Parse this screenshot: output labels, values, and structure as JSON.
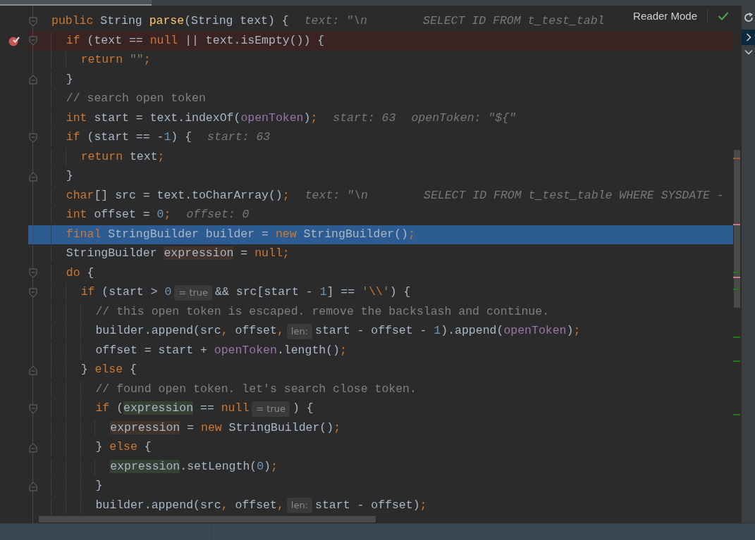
{
  "editor": {
    "lines": [
      {
        "kind": "fold-start",
        "breakpoint": false,
        "current": false,
        "tokens": [
          {
            "kind": "kw",
            "text": "public"
          },
          {
            "kind": "id",
            "text": " String "
          },
          {
            "kind": "fn",
            "text": "parse"
          },
          {
            "kind": "id",
            "text": "(String text) {"
          },
          {
            "kind": "hint",
            "text": "text: \"\\n        SELECT ID FROM t_test_tabl"
          }
        ]
      },
      {
        "kind": "fold-start",
        "breakpoint": true,
        "current": false,
        "tokens": [
          {
            "kind": "kw",
            "text": "  if"
          },
          {
            "kind": "id",
            "text": " (text == "
          },
          {
            "kind": "kw",
            "text": "null"
          },
          {
            "kind": "id",
            "text": " || text.isEmpty()) {"
          }
        ]
      },
      {
        "kind": "plain",
        "breakpoint": false,
        "current": false,
        "tokens": [
          {
            "kind": "kw",
            "text": "    return "
          },
          {
            "kind": "str",
            "text": "\"\""
          },
          {
            "kind": "kw",
            "text": ";"
          }
        ]
      },
      {
        "kind": "fold-end",
        "breakpoint": false,
        "current": false,
        "tokens": [
          {
            "kind": "id",
            "text": "  }"
          }
        ]
      },
      {
        "kind": "plain",
        "breakpoint": false,
        "current": false,
        "tokens": [
          {
            "kind": "comment",
            "text": "  // search open token"
          }
        ]
      },
      {
        "kind": "plain",
        "breakpoint": false,
        "current": false,
        "tokens": [
          {
            "kind": "kw",
            "text": "  int"
          },
          {
            "kind": "id",
            "text": " start = text.indexOf("
          },
          {
            "kind": "field",
            "text": "openToken"
          },
          {
            "kind": "id",
            "text": ")"
          },
          {
            "kind": "kw",
            "text": ";"
          },
          {
            "kind": "hint",
            "text": "start: 63"
          },
          {
            "kind": "hint",
            "text": "openToken: \"${\""
          }
        ]
      },
      {
        "kind": "fold-start",
        "breakpoint": false,
        "current": false,
        "tokens": [
          {
            "kind": "kw",
            "text": "  if"
          },
          {
            "kind": "id",
            "text": " (start == -"
          },
          {
            "kind": "num",
            "text": "1"
          },
          {
            "kind": "id",
            "text": ") {"
          },
          {
            "kind": "hint",
            "text": "start: 63"
          }
        ]
      },
      {
        "kind": "plain",
        "breakpoint": false,
        "current": false,
        "tokens": [
          {
            "kind": "kw",
            "text": "    return"
          },
          {
            "kind": "id",
            "text": " text"
          },
          {
            "kind": "kw",
            "text": ";"
          }
        ]
      },
      {
        "kind": "fold-end",
        "breakpoint": false,
        "current": false,
        "tokens": [
          {
            "kind": "id",
            "text": "  }"
          }
        ]
      },
      {
        "kind": "plain",
        "breakpoint": false,
        "current": false,
        "tokens": [
          {
            "kind": "kw",
            "text": "  char"
          },
          {
            "kind": "id",
            "text": "[] src = text.toCharArray()"
          },
          {
            "kind": "kw",
            "text": ";"
          },
          {
            "kind": "hint",
            "text": "text: \"\\n        SELECT ID FROM t_test_table WHERE SYSDATE -"
          }
        ]
      },
      {
        "kind": "plain",
        "breakpoint": false,
        "current": false,
        "tokens": [
          {
            "kind": "kw",
            "text": "  int"
          },
          {
            "kind": "id",
            "text": " offset = "
          },
          {
            "kind": "num",
            "text": "0"
          },
          {
            "kind": "kw",
            "text": ";"
          },
          {
            "kind": "hint",
            "text": "offset: 0"
          }
        ]
      },
      {
        "kind": "plain",
        "breakpoint": false,
        "current": true,
        "tokens": [
          {
            "kind": "kw",
            "text": "  final"
          },
          {
            "kind": "id",
            "text": " StringBuilder builder = "
          },
          {
            "kind": "kw",
            "text": "new"
          },
          {
            "kind": "id",
            "text": " StringBuilder()"
          },
          {
            "kind": "kw",
            "text": ";"
          }
        ]
      },
      {
        "kind": "plain",
        "breakpoint": false,
        "current": false,
        "tokens": [
          {
            "kind": "id",
            "text": "  StringBuilder "
          },
          {
            "kind": "write",
            "text": "expression"
          },
          {
            "kind": "id",
            "text": " = "
          },
          {
            "kind": "kw",
            "text": "null;"
          }
        ]
      },
      {
        "kind": "fold-start",
        "breakpoint": false,
        "current": false,
        "tokens": [
          {
            "kind": "kw",
            "text": "  do"
          },
          {
            "kind": "id",
            "text": " {"
          }
        ]
      },
      {
        "kind": "fold-start",
        "breakpoint": false,
        "current": false,
        "tokens": [
          {
            "kind": "kw",
            "text": "    if"
          },
          {
            "kind": "id",
            "text": " (start > "
          },
          {
            "kind": "num",
            "text": "0"
          },
          {
            "kind": "inlay",
            "text": "= true"
          },
          {
            "kind": "id",
            "text": "&& src[start - "
          },
          {
            "kind": "num",
            "text": "1"
          },
          {
            "kind": "id",
            "text": "] == "
          },
          {
            "kind": "str",
            "text": "'"
          },
          {
            "kind": "kw",
            "text": "\\\\"
          },
          {
            "kind": "str",
            "text": "'"
          },
          {
            "kind": "id",
            "text": ") {"
          }
        ]
      },
      {
        "kind": "plain",
        "breakpoint": false,
        "current": false,
        "tokens": [
          {
            "kind": "comment",
            "text": "      // this open token is escaped. remove the backslash and continue."
          }
        ]
      },
      {
        "kind": "plain",
        "breakpoint": false,
        "current": false,
        "tokens": [
          {
            "kind": "id",
            "text": "      builder.append(src"
          },
          {
            "kind": "kw",
            "text": ","
          },
          {
            "kind": "id",
            "text": " offset"
          },
          {
            "kind": "kw",
            "text": ","
          },
          {
            "kind": "inlay",
            "text": "len:"
          },
          {
            "kind": "id",
            "text": "start - offset - "
          },
          {
            "kind": "num",
            "text": "1"
          },
          {
            "kind": "id",
            "text": ").append("
          },
          {
            "kind": "field",
            "text": "openToken"
          },
          {
            "kind": "id",
            "text": ")"
          },
          {
            "kind": "kw",
            "text": ";"
          }
        ]
      },
      {
        "kind": "plain",
        "breakpoint": false,
        "current": false,
        "tokens": [
          {
            "kind": "id",
            "text": "      offset = start + "
          },
          {
            "kind": "field",
            "text": "openToken"
          },
          {
            "kind": "id",
            "text": ".length()"
          },
          {
            "kind": "kw",
            "text": ";"
          }
        ]
      },
      {
        "kind": "fold-end",
        "breakpoint": false,
        "current": false,
        "tokens": [
          {
            "kind": "id",
            "text": "    } "
          },
          {
            "kind": "kw",
            "text": "else"
          },
          {
            "kind": "id",
            "text": " {"
          }
        ]
      },
      {
        "kind": "plain",
        "breakpoint": false,
        "current": false,
        "tokens": [
          {
            "kind": "comment",
            "text": "      // found open token. let's search close token."
          }
        ]
      },
      {
        "kind": "fold-start",
        "breakpoint": false,
        "current": false,
        "tokens": [
          {
            "kind": "kw",
            "text": "      if"
          },
          {
            "kind": "id",
            "text": " ("
          },
          {
            "kind": "read",
            "text": "expression"
          },
          {
            "kind": "id",
            "text": " == "
          },
          {
            "kind": "kw",
            "text": "null"
          },
          {
            "kind": "inlay",
            "text": "= true"
          },
          {
            "kind": "id",
            "text": ") {"
          }
        ]
      },
      {
        "kind": "plain",
        "breakpoint": false,
        "current": false,
        "tokens": [
          {
            "kind": "write",
            "text": "        expression"
          },
          {
            "kind": "id",
            "text": " = "
          },
          {
            "kind": "kw",
            "text": "new"
          },
          {
            "kind": "id",
            "text": " StringBuilder()"
          },
          {
            "kind": "kw",
            "text": ";"
          }
        ]
      },
      {
        "kind": "fold-end",
        "breakpoint": false,
        "current": false,
        "tokens": [
          {
            "kind": "id",
            "text": "      } "
          },
          {
            "kind": "kw",
            "text": "else"
          },
          {
            "kind": "id",
            "text": " {"
          }
        ]
      },
      {
        "kind": "plain",
        "breakpoint": false,
        "current": false,
        "tokens": [
          {
            "kind": "read",
            "text": "        expression"
          },
          {
            "kind": "id",
            "text": ".setLength("
          },
          {
            "kind": "num",
            "text": "0"
          },
          {
            "kind": "id",
            "text": ")"
          },
          {
            "kind": "kw",
            "text": ";"
          }
        ]
      },
      {
        "kind": "fold-end",
        "breakpoint": false,
        "current": false,
        "tokens": [
          {
            "kind": "id",
            "text": "      }"
          }
        ]
      },
      {
        "kind": "plain",
        "breakpoint": false,
        "current": false,
        "tokens": [
          {
            "kind": "id",
            "text": "      builder.append(src"
          },
          {
            "kind": "kw",
            "text": ","
          },
          {
            "kind": "id",
            "text": " offset"
          },
          {
            "kind": "kw",
            "text": ","
          },
          {
            "kind": "inlay",
            "text": "len:"
          },
          {
            "kind": "id",
            "text": "start - offset)"
          },
          {
            "kind": "kw",
            "text": ";"
          }
        ]
      }
    ]
  },
  "reader_mode": {
    "label": "Reader Mode"
  }
}
